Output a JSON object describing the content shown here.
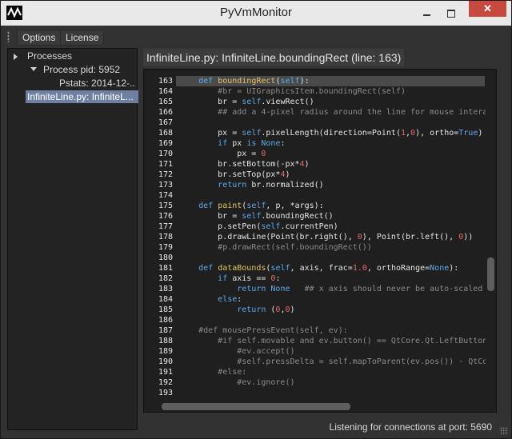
{
  "window": {
    "title": "PyVmMonitor",
    "close_label": "✕"
  },
  "menu": {
    "options_label": "Options",
    "license_label": "License"
  },
  "tree": {
    "root": "Processes",
    "process": "Process pid: 5952",
    "pstats": "Pstats: 2014-12-...",
    "selected_file": "InfiniteLine.py: InfiniteL..."
  },
  "panel": {
    "title": "InfiniteLine.py: InfiniteLine.boundingRect (line: 163)"
  },
  "code": {
    "lines": [
      {
        "n": "163",
        "t": "    def boundingRect(self):"
      },
      {
        "n": "164",
        "t": "        #br = UIGraphicsItem.boundingRect(self)"
      },
      {
        "n": "165",
        "t": "        br = self.viewRect()"
      },
      {
        "n": "166",
        "t": "        ## add a 4-pixel radius around the line for mouse interac"
      },
      {
        "n": "167",
        "t": ""
      },
      {
        "n": "168",
        "t": "        px = self.pixelLength(direction=Point(1,0), ortho=True)"
      },
      {
        "n": "169",
        "t": "        if px is None:"
      },
      {
        "n": "170",
        "t": "            px = 0"
      },
      {
        "n": "171",
        "t": "        br.setBottom(-px*4)"
      },
      {
        "n": "172",
        "t": "        br.setTop(px*4)"
      },
      {
        "n": "173",
        "t": "        return br.normalized()"
      },
      {
        "n": "174",
        "t": ""
      },
      {
        "n": "175",
        "t": "    def paint(self, p, *args):"
      },
      {
        "n": "176",
        "t": "        br = self.boundingRect()"
      },
      {
        "n": "177",
        "t": "        p.setPen(self.currentPen)"
      },
      {
        "n": "178",
        "t": "        p.drawLine(Point(br.right(), 0), Point(br.left(), 0))"
      },
      {
        "n": "179",
        "t": "        #p.drawRect(self.boundingRect())"
      },
      {
        "n": "180",
        "t": ""
      },
      {
        "n": "181",
        "t": "    def dataBounds(self, axis, frac=1.0, orthoRange=None):"
      },
      {
        "n": "182",
        "t": "        if axis == 0:"
      },
      {
        "n": "183",
        "t": "            return None   ## x axis should never be auto-scaled"
      },
      {
        "n": "184",
        "t": "        else:"
      },
      {
        "n": "185",
        "t": "            return (0,0)"
      },
      {
        "n": "186",
        "t": ""
      },
      {
        "n": "187",
        "t": "    #def mousePressEvent(self, ev):"
      },
      {
        "n": "188",
        "t": "        #if self.movable and ev.button() == QtCore.Qt.LeftButton:"
      },
      {
        "n": "189",
        "t": "            #ev.accept()"
      },
      {
        "n": "190",
        "t": "            #self.pressDelta = self.mapToParent(ev.pos()) - QtCor"
      },
      {
        "n": "191",
        "t": "        #else:"
      },
      {
        "n": "192",
        "t": "            #ev.ignore()"
      },
      {
        "n": "193",
        "t": ""
      }
    ]
  },
  "status": {
    "text": "Listening for connections at port: 5690"
  },
  "colors": {
    "keyword": "#5fa8e8",
    "comment": "#8a8a8a",
    "number": "#e26a6a",
    "function_name": "#e0c46c"
  }
}
